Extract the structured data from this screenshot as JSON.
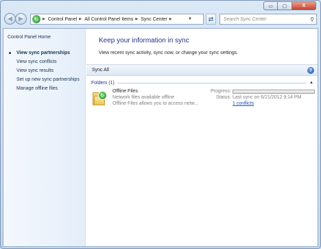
{
  "window": {
    "caption_buttons": {
      "minimize": "▭",
      "maximize": "▢",
      "close": "X"
    }
  },
  "nav": {
    "back_icon": "back-arrow",
    "forward_icon": "forward-arrow"
  },
  "address": {
    "crumbs": [
      "Control Panel",
      "All Control Panel Items",
      "Sync Center"
    ]
  },
  "search": {
    "placeholder": "Search Sync Center"
  },
  "sidebar": {
    "home": "Control Panel Home",
    "items": [
      {
        "label": "View sync partnerships",
        "active": true
      },
      {
        "label": "View sync conflicts",
        "active": false
      },
      {
        "label": "View sync results",
        "active": false
      },
      {
        "label": "Set up new sync partnerships",
        "active": false
      },
      {
        "label": "Manage offline files",
        "active": false
      }
    ]
  },
  "main": {
    "title": "Keep your information in sync",
    "subtitle": "View recent sync activity, sync now, or change your sync settings.",
    "toolbar": {
      "sync_all": "Sync All",
      "help": "?"
    },
    "group": {
      "title": "Folders (1)"
    },
    "item": {
      "name": "Offline Files",
      "description1": "Network files available offline",
      "description2": "Offline Files allows you to access netw...",
      "progress_label": "Progress:",
      "progress_value": 0,
      "status_label": "Status:",
      "status_value": "Last sync on 6/21/2012 9:14 PM",
      "conflicts_link": "1 conflicts"
    }
  },
  "colors": {
    "title": "#1e3287",
    "link": "#1f4fb0",
    "sidebar_text": "#16324f"
  }
}
